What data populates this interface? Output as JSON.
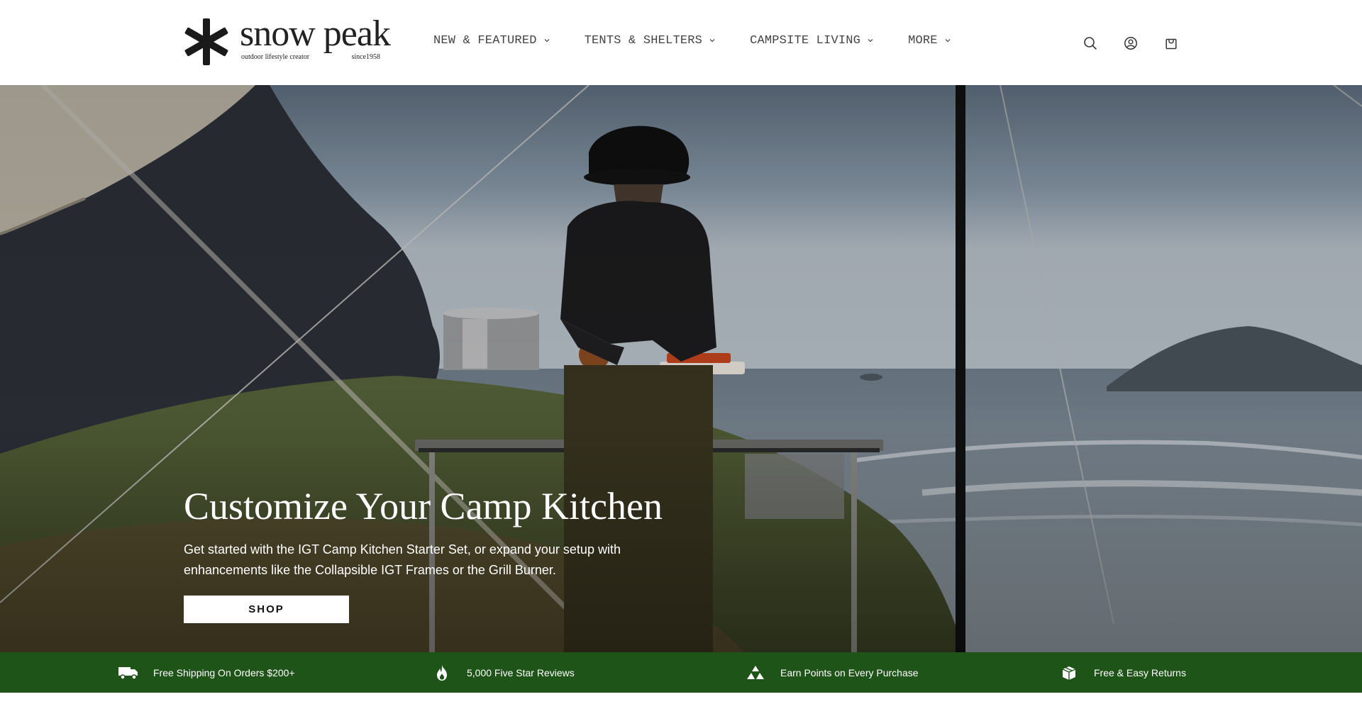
{
  "brand": {
    "name": "snow peak",
    "tagline": "outdoor lifestyle creator",
    "since": "since1958"
  },
  "nav": {
    "items": [
      {
        "label": "NEW & FEATURED"
      },
      {
        "label": "TENTS & SHELTERS"
      },
      {
        "label": "CAMPSITE LIVING"
      },
      {
        "label": "MORE"
      }
    ]
  },
  "utility_icons": [
    "search-icon",
    "account-icon",
    "cart-icon"
  ],
  "hero": {
    "title": "Customize Your Camp Kitchen",
    "subtitle": "Get started with the IGT Camp Kitchen Starter Set, or expand your setup with enhancements like the Collapsible IGT Frames or the Grill Burner.",
    "cta_label": "SHOP"
  },
  "benefits": [
    {
      "icon": "truck-icon",
      "label": "Free Shipping On Orders $200+"
    },
    {
      "icon": "flame-icon",
      "label": "5,000 Five Star Reviews"
    },
    {
      "icon": "mountain-icon",
      "label": "Earn Points on Every Purchase"
    },
    {
      "icon": "box-return-icon",
      "label": "Free & Easy Returns"
    }
  ],
  "colors": {
    "benefits_bar": "#1f5419",
    "header_bg": "#ffffff",
    "nav_text": "#444444"
  }
}
